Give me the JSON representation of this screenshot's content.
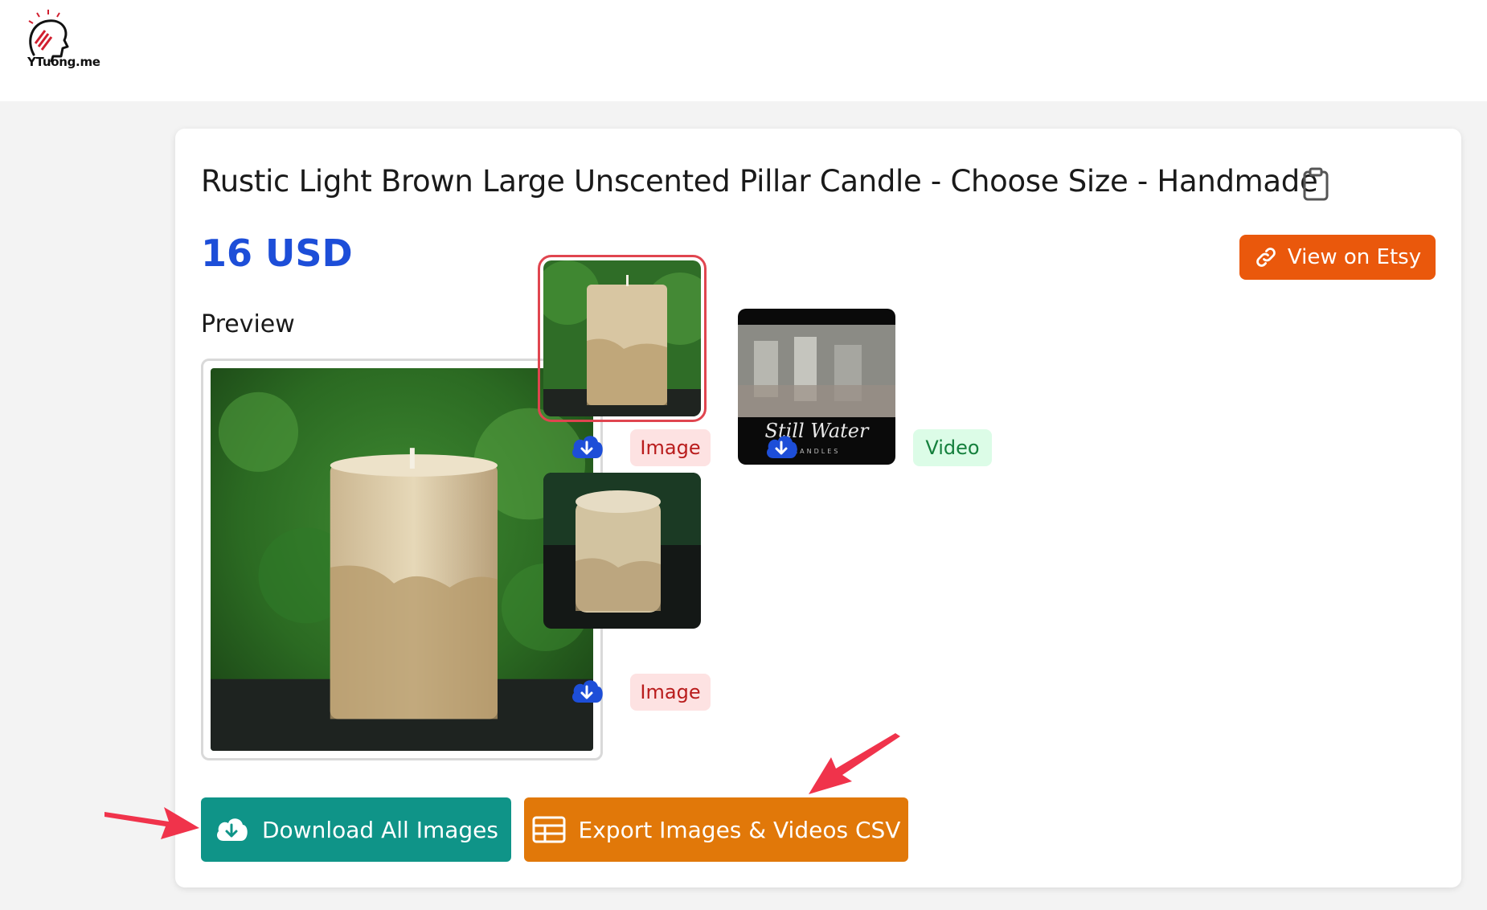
{
  "header": {
    "logo_text": "YTuong.me"
  },
  "product": {
    "title": "Rustic Light Brown Large Unscented Pillar Candle - Choose Size - Handmade",
    "price": "16 USD",
    "view_button_label": "View on Etsy"
  },
  "preview": {
    "label": "Preview"
  },
  "media": [
    {
      "type_label": "Image",
      "selected": true
    },
    {
      "type_label": "Video",
      "selected": false,
      "overlay_text": "Still Water",
      "overlay_subtext": "CANDLES"
    },
    {
      "type_label": "Image",
      "selected": false
    }
  ],
  "actions": {
    "download_all_label": "Download All Images",
    "export_csv_label": "Export Images & Videos CSV"
  },
  "colors": {
    "price": "#1d4ed8",
    "etsy_button": "#ea580c",
    "download_all": "#0f9488",
    "export_csv": "#e17809",
    "image_badge_bg": "#fde2e2",
    "video_badge_bg": "#dcfce7",
    "arrow": "#f0334b"
  }
}
